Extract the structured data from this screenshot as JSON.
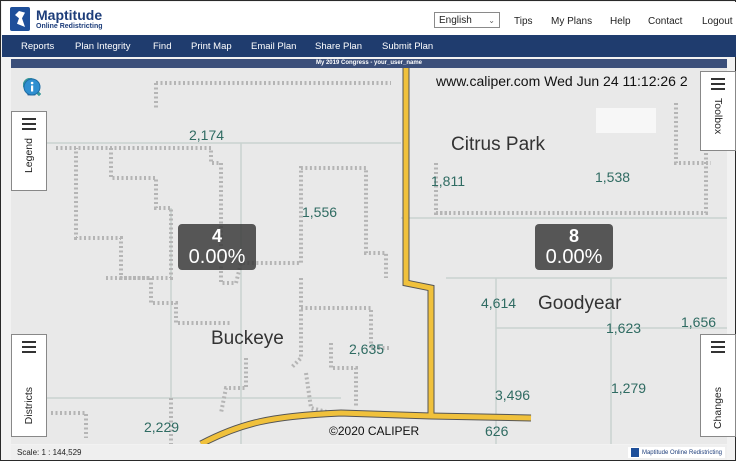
{
  "header": {
    "logo_title": "Maptitude",
    "logo_subtitle": "Online Redistricting",
    "language": "English",
    "links": [
      "Tips",
      "My Plans",
      "Help",
      "Contact",
      "Logout"
    ]
  },
  "nav": {
    "items": [
      "Reports",
      "Plan Integrity",
      "Find",
      "Print Map",
      "Email Plan",
      "Share Plan",
      "Submit Plan"
    ]
  },
  "plan_title": "My 2019 Congress - your_user_name",
  "map": {
    "watermark": "www.caliper.com Wed Jun 24 11:12:26 2",
    "copyright": "©2020 CALIPER",
    "places": [
      "Citrus Park",
      "Goodyear",
      "Buckeye"
    ],
    "counts": [
      "2,174",
      "1,811",
      "1,538",
      "1,556",
      "4,614",
      "1,623",
      "1,656",
      "2,635",
      "3,496",
      "1,279",
      "2,229",
      "626"
    ],
    "districts": [
      {
        "number": "4",
        "percent": "0.00%"
      },
      {
        "number": "8",
        "percent": "0.00%"
      }
    ]
  },
  "tools": [
    "zoom-extent-icon",
    "zoom-in-icon",
    "zoom-out-icon",
    "pan-hand-icon",
    "info-icon"
  ],
  "panels": {
    "legend": "Legend",
    "districts": "Districts",
    "toolbox": "Toolbox",
    "changes": "Changes"
  },
  "status": {
    "scale": "Scale: 1 : 144,529",
    "brand": "Maptitude Online Redistricting"
  },
  "colors": {
    "nav_bg": "#1f3c6e",
    "road_yellow": "#f0c13c",
    "boundary_gray": "#b5b5b5",
    "label_teal": "#2f6b62"
  }
}
